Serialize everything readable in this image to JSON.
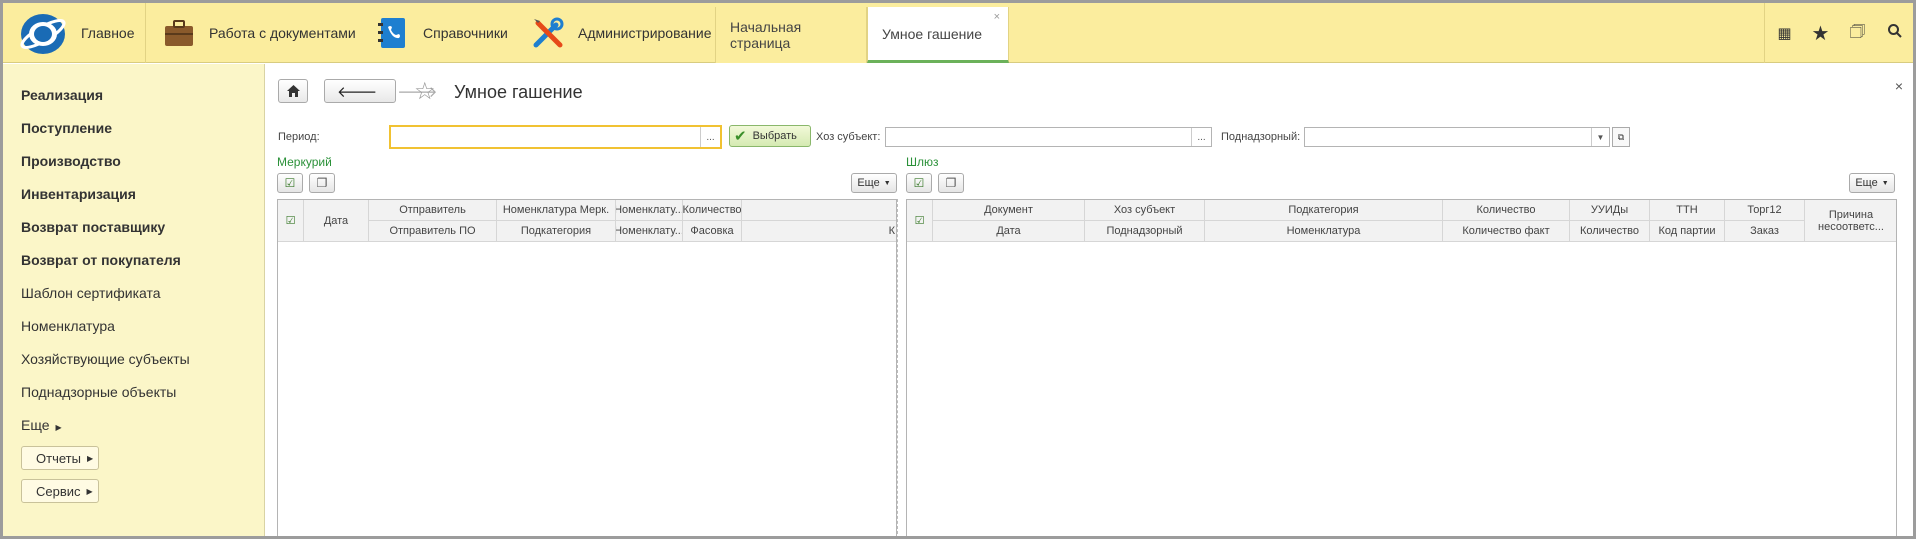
{
  "topbar": {
    "home_label": "Главное",
    "sections": [
      {
        "label": "Работа с документами",
        "icon": "briefcase-icon"
      },
      {
        "label": "Справочники",
        "icon": "phonebook-icon"
      },
      {
        "label": "Администрирование",
        "icon": "tools-icon"
      }
    ],
    "tabs": [
      {
        "label": "Начальная страница"
      },
      {
        "label": "Умное гашение",
        "close": "×"
      }
    ],
    "tools": {
      "apps": "⋮⋮⋮",
      "favorites": "★",
      "history": "◷",
      "search": "⚲"
    }
  },
  "sidebar": {
    "items": [
      {
        "label": "Реализация"
      },
      {
        "label": "Поступление"
      },
      {
        "label": "Производство"
      },
      {
        "label": "Инвентаризация"
      },
      {
        "label": "Возврат поставщику"
      },
      {
        "label": "Возврат от покупателя"
      },
      {
        "label": "Шаблон сертификата"
      },
      {
        "label": "Номенклатура"
      },
      {
        "label": "Хозяйствующие субъекты"
      },
      {
        "label": "Поднадзорные объекты"
      },
      {
        "label": "Еще"
      }
    ],
    "reports_button": "Отчеты",
    "service_button": "Сервис"
  },
  "form": {
    "title": "Умное гашение",
    "close": "×",
    "period_label": "Период:",
    "period_value": "",
    "period_dots": "...",
    "choose_button": "Выбрать",
    "entity_label": "Хоз субъект:",
    "entity_value": "",
    "entity_dots": "...",
    "supervised_label": "Поднадзорный:",
    "supervised_value": ""
  },
  "left_panel": {
    "title": "Меркурий",
    "more_button": "Еще",
    "columns_top": [
      "Дата",
      "Отправитель",
      "Номенклатура Мерк.",
      "Номенклату...",
      "Количество",
      ""
    ],
    "columns_bottom": [
      "Отправитель ПО",
      "Подкатегория",
      "Номенклату...",
      "Фасовка",
      "К"
    ]
  },
  "right_panel": {
    "title": "Шлюз",
    "more_button": "Еще",
    "columns_top": [
      "Документ",
      "Хоз субъект",
      "Подкатегория",
      "Количество",
      "УУИДы",
      "ТТН",
      "Торг12",
      "Причина несоответс..."
    ],
    "columns_bottom": [
      "Дата",
      "Поднадзорный",
      "Номенклатура",
      "Количество факт",
      "Количество",
      "Код партии",
      "Заказ"
    ]
  }
}
